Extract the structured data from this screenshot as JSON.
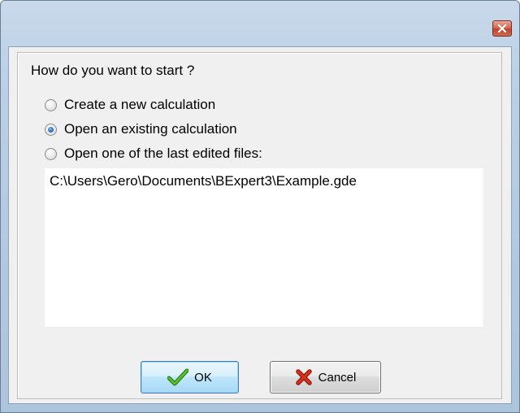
{
  "window": {
    "close_icon": "close-icon"
  },
  "dialog": {
    "question": "How do you want to start ?",
    "options": [
      {
        "label": "Create a new calculation",
        "checked": false
      },
      {
        "label": "Open an existing calculation",
        "checked": true
      },
      {
        "label": "Open one of the last edited files:",
        "checked": false
      }
    ],
    "recent_files": [
      "C:\\Users\\Gero\\Documents\\BExpert3\\Example.gde"
    ],
    "buttons": {
      "ok_label": "OK",
      "ok_icon": "checkmark-icon",
      "cancel_label": "Cancel",
      "cancel_icon": "x-icon"
    }
  },
  "colors": {
    "title_bar": "#bcd0e6",
    "client_bg": "#f0f0f0",
    "close_button": "#c1412c",
    "ok_button": "#bee6fd",
    "checkmark": "#3a9a1d",
    "cancel_x": "#cc2a1a"
  }
}
